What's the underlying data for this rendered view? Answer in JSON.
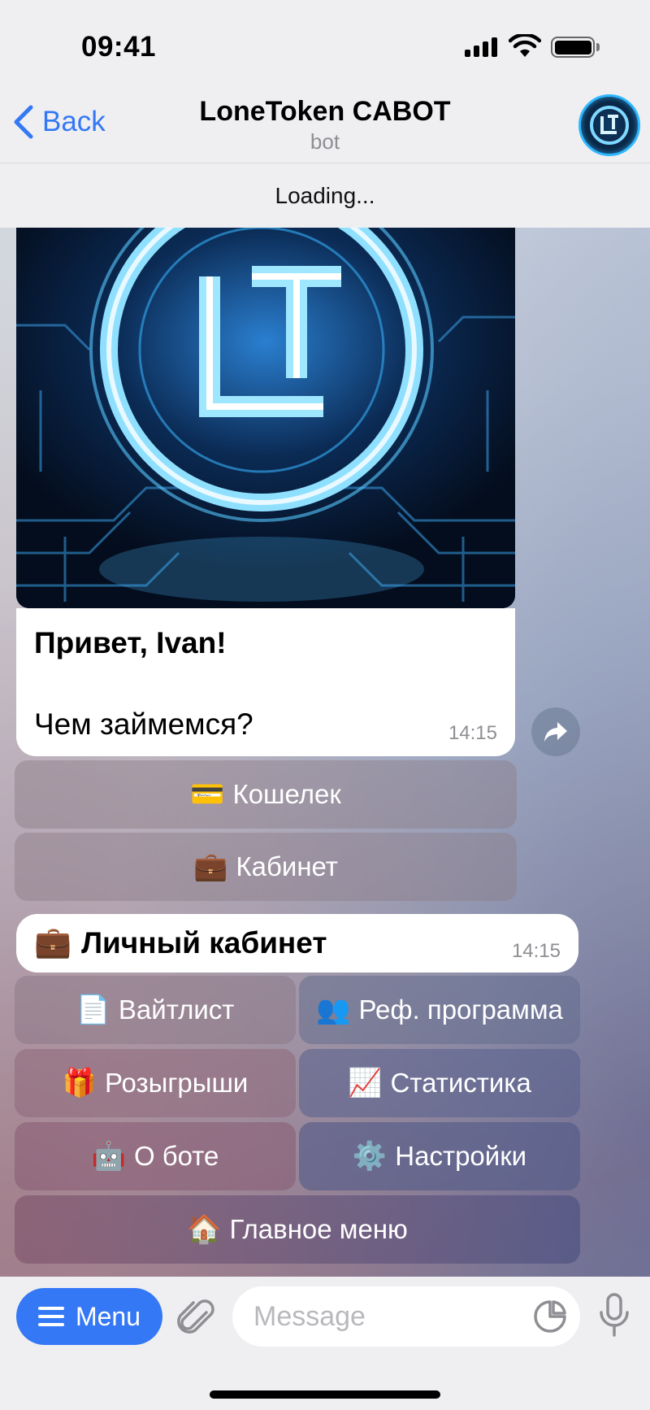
{
  "status_bar": {
    "time": "09:41"
  },
  "nav": {
    "back_label": "Back",
    "title": "LoneToken CABOT",
    "subtitle": "bot"
  },
  "loading_text": "Loading...",
  "welcome_message": {
    "greeting": "Привет, Ivan!",
    "question": "Чем займемся?",
    "time": "14:15"
  },
  "welcome_keyboard": [
    {
      "emoji": "💳",
      "label": "Кошелек"
    },
    {
      "emoji": "💼",
      "label": "Кабинет"
    }
  ],
  "cabinet_message": {
    "emoji": "💼",
    "title": "Личный кабинет",
    "time": "14:15"
  },
  "cabinet_keyboard": [
    {
      "emoji": "📄",
      "label": "Вайтлист"
    },
    {
      "emoji": "👥",
      "label": "Реф. программа"
    },
    {
      "emoji": "🎁",
      "label": "Розыгрыши"
    },
    {
      "emoji": "📈",
      "label": "Статистика"
    },
    {
      "emoji": "🤖",
      "label": "О боте"
    },
    {
      "emoji": "⚙️",
      "label": "Настройки"
    },
    {
      "emoji": "🏠",
      "label": "Главное меню"
    }
  ],
  "input_bar": {
    "menu_label": "Menu",
    "message_placeholder": "Message"
  },
  "colors": {
    "accent": "#3478f6",
    "glow": "#2fb7ff"
  }
}
